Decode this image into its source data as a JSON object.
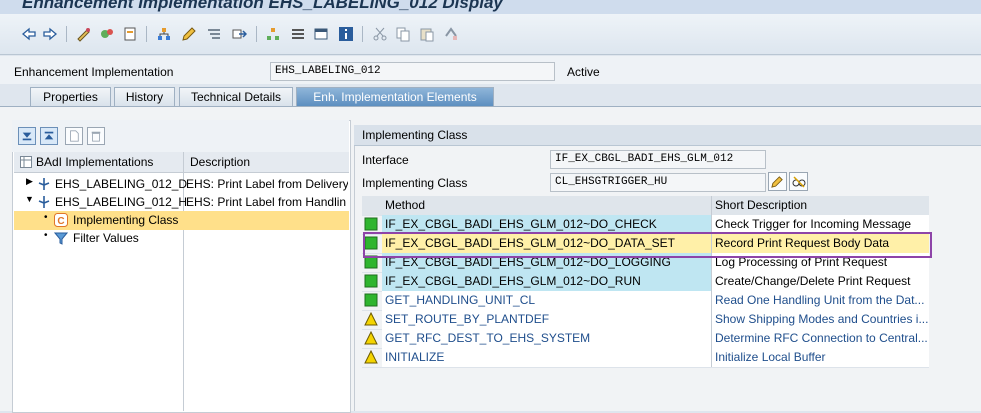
{
  "window": {
    "title": "Enhancement Implementation EHS_LABELING_012 Display"
  },
  "header": {
    "field_label": "Enhancement Implementation",
    "field_value": "EHS_LABELING_012",
    "status": "Active"
  },
  "tabs": [
    {
      "label": "Properties"
    },
    {
      "label": "History"
    },
    {
      "label": "Technical Details"
    },
    {
      "label": "Enh. Implementation Elements"
    }
  ],
  "tree": {
    "columns": {
      "name": "BAdI Implementations",
      "desc": "Description"
    },
    "rows": [
      {
        "name": "EHS_LABELING_012_D",
        "desc": "EHS: Print Label from Delivery"
      },
      {
        "name": "EHS_LABELING_012_H",
        "desc": "EHS: Print Label from Handlin"
      },
      {
        "name": "Implementing Class",
        "desc": ""
      },
      {
        "name": "Filter Values",
        "desc": ""
      }
    ]
  },
  "panel": {
    "title": "Implementing Class",
    "interface_label": "Interface",
    "interface_value": "IF_EX_CBGL_BADI_EHS_GLM_012",
    "class_label": "Implementing Class",
    "class_value": "CL_EHSGTRIGGER_HU"
  },
  "methods": {
    "columns": {
      "method": "Method",
      "desc": "Short Description"
    },
    "rows": [
      {
        "status": "green",
        "method": "IF_EX_CBGL_BADI_EHS_GLM_012~DO_CHECK",
        "desc": "Check Trigger for Incoming Message"
      },
      {
        "status": "green",
        "method": "IF_EX_CBGL_BADI_EHS_GLM_012~DO_DATA_SET",
        "desc": "Record Print Request Body Data"
      },
      {
        "status": "green",
        "method": "IF_EX_CBGL_BADI_EHS_GLM_012~DO_LOGGING",
        "desc": "Log Processing of Print Request"
      },
      {
        "status": "green",
        "method": "IF_EX_CBGL_BADI_EHS_GLM_012~DO_RUN",
        "desc": "Create/Change/Delete Print Request"
      },
      {
        "status": "green",
        "method": "GET_HANDLING_UNIT_CL",
        "desc": "Read One Handling Unit from the Dat..."
      },
      {
        "status": "yellow",
        "method": "SET_ROUTE_BY_PLANTDEF",
        "desc": "Show Shipping Modes and Countries i..."
      },
      {
        "status": "yellow",
        "method": "GET_RFC_DEST_TO_EHS_SYSTEM",
        "desc": "Determine RFC Connection to Central..."
      },
      {
        "status": "yellow",
        "method": "INITIALIZE",
        "desc": "Initialize Local Buffer"
      }
    ]
  },
  "colors": {
    "highlight_border": "#8e44a8",
    "selected_row": "#fff0a8",
    "interface_row": "#bfe6f2",
    "status_green": "#2fb52f",
    "status_yellow": "#f4d400",
    "desc_blue": "#1f4e8c"
  }
}
